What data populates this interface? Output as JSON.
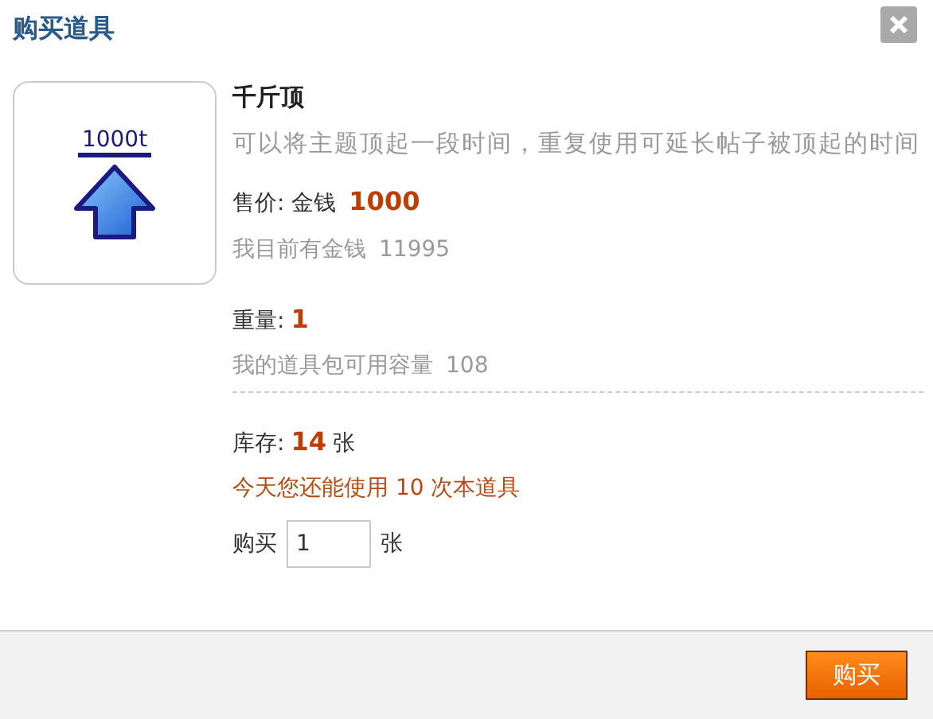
{
  "dialog": {
    "title": "购买道具"
  },
  "item": {
    "icon_text": "1000t",
    "name": "千斤顶",
    "description": "可以将主题顶起一段时间，重复使用可延长帖子被顶起的时间"
  },
  "price": {
    "label": "售价: 金钱",
    "amount": "1000"
  },
  "balance": {
    "label": "我目前有金钱",
    "value": "11995"
  },
  "weight": {
    "label": "重量:",
    "value": "1"
  },
  "capacity": {
    "label": "我的道具包可用容量",
    "value": "108"
  },
  "stock": {
    "label": "库存:",
    "value": "14",
    "unit": "张"
  },
  "usage_notice": "今天您还能使用 10 次本道具",
  "purchase": {
    "label": "购买",
    "quantity": "1",
    "unit": "张"
  },
  "buy_button": "购买"
}
